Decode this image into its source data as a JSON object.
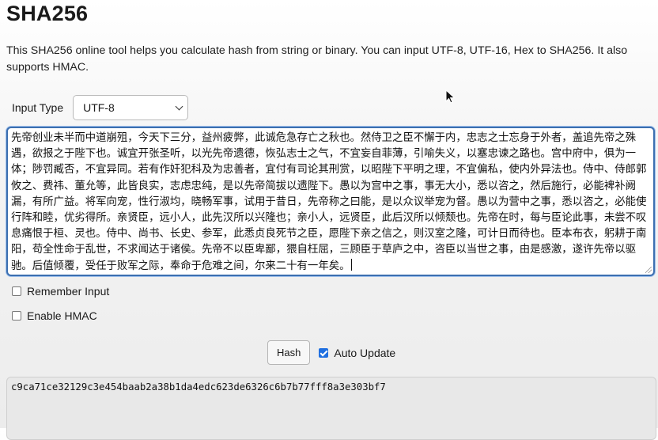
{
  "page": {
    "title": "SHA256",
    "description": "This SHA256 online tool helps you calculate hash from string or binary. You can input UTF-8, UTF-16, Hex to SHA256. It also supports HMAC."
  },
  "input_type": {
    "label": "Input Type",
    "selected": "UTF-8"
  },
  "input_text": "先帝创业未半而中道崩殂，今天下三分，益州疲弊，此诚危急存亡之秋也。然侍卫之臣不懈于内，忠志之士忘身于外者，盖追先帝之殊遇，欲报之于陛下也。诚宜开张圣听，以光先帝遗德，恢弘志士之气，不宜妄自菲薄，引喻失义，以塞忠谏之路也。宫中府中，俱为一体；陟罚臧否，不宜异同。若有作奸犯科及为忠善者，宜付有司论其刑赏，以昭陛下平明之理，不宜偏私，使内外异法也。侍中、侍郎郭攸之、费祎、董允等，此皆良实，志虑忠纯，是以先帝简拔以遗陛下。愚以为宫中之事，事无大小，悉以咨之，然后施行，必能裨补阙漏，有所广益。将军向宠，性行淑均，晓畅军事，试用于昔日，先帝称之曰能，是以众议举宠为督。愚以为营中之事，悉以咨之，必能使行阵和睦，优劣得所。亲贤臣，远小人，此先汉所以兴隆也；亲小人，远贤臣，此后汉所以倾颓也。先帝在时，每与臣论此事，未尝不叹息痛恨于桓、灵也。侍中、尚书、长史、参军，此悉贞良死节之臣，愿陛下亲之信之，则汉室之隆，可计日而待也。臣本布衣，躬耕于南阳，苟全性命于乱世，不求闻达于诸侯。先帝不以臣卑鄙，猥自枉屈，三顾臣于草庐之中，咨臣以当世之事，由是感激，遂许先帝以驱驰。后值倾覆，受任于败军之际，奉命于危难之间，尔来二十有一年矣。",
  "options": {
    "remember_input": {
      "label": "Remember Input",
      "checked": false
    },
    "enable_hmac": {
      "label": "Enable HMAC",
      "checked": false
    },
    "auto_update": {
      "label": "Auto Update",
      "checked": true
    }
  },
  "buttons": {
    "hash": "Hash"
  },
  "output": {
    "value": "c9ca71ce32129c3e454baab2a38b1da4edc623de6326c6b7b77fff8a3e303bf7"
  },
  "colors": {
    "accent": "#1f6fe0",
    "focus_border": "#3c6fb0",
    "output_bg": "#e8e8e8"
  },
  "icons": {
    "cursor": "mouse-pointer-icon",
    "select": "chevron-down-icon"
  }
}
